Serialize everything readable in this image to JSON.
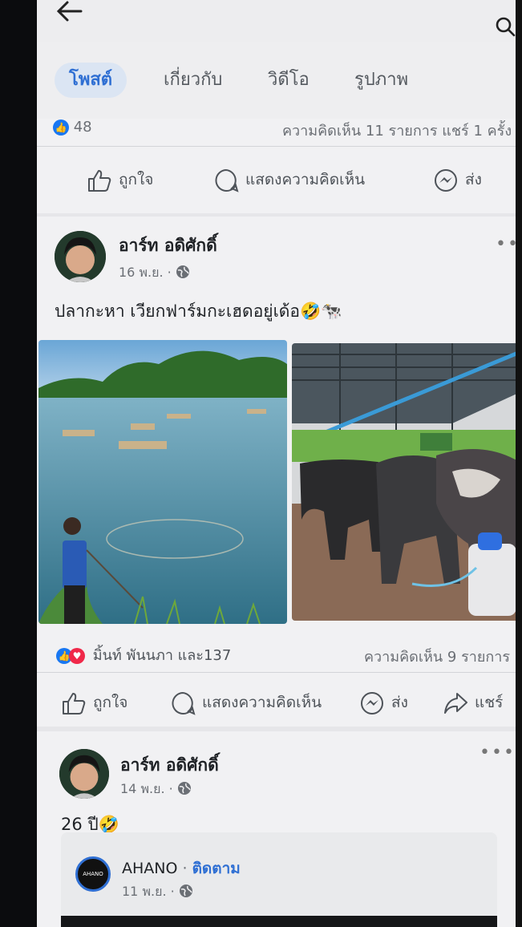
{
  "tabs": [
    "โพสต์",
    "เกี่ยวกับ",
    "วิดีโอ",
    "รูปภาพ"
  ],
  "prev_post": {
    "reaction_count": "48",
    "stats": "ความคิดเห็น 11 รายการ แชร์ 1 ครั้ง"
  },
  "actions": {
    "like": "ถูกใจ",
    "comment": "แสดงความคิดเห็น",
    "send": "ส่ง",
    "share": "แชร์"
  },
  "post1": {
    "author": "อาร์ท อดิศักดิ์",
    "date": "16 พ.ย. ·",
    "text": "ปลากะหา เวียกฟาร์มกะเฮดอยู่เด้อ🤣🐄",
    "reactions": "มิ้นท์ พันนภา และ137",
    "comments": "ความคิดเห็น 9 รายการ"
  },
  "post2": {
    "author": "อาร์ท อดิศักดิ์",
    "date": "14 พ.ย. ·",
    "text": "26 ปี🤣",
    "shared_page": "AHANO",
    "follow": "ติดตาม",
    "shared_date": "11 พ.ย. ·",
    "logo_text": "AHANO"
  },
  "colors": {
    "accent": "#2f6fd3",
    "like_blue": "#1877f2",
    "love_red": "#f02849"
  },
  "icons": [
    "back-arrow-icon",
    "search-icon",
    "like-icon",
    "comment-icon",
    "messenger-icon",
    "share-icon",
    "globe-icon",
    "more-icon"
  ]
}
